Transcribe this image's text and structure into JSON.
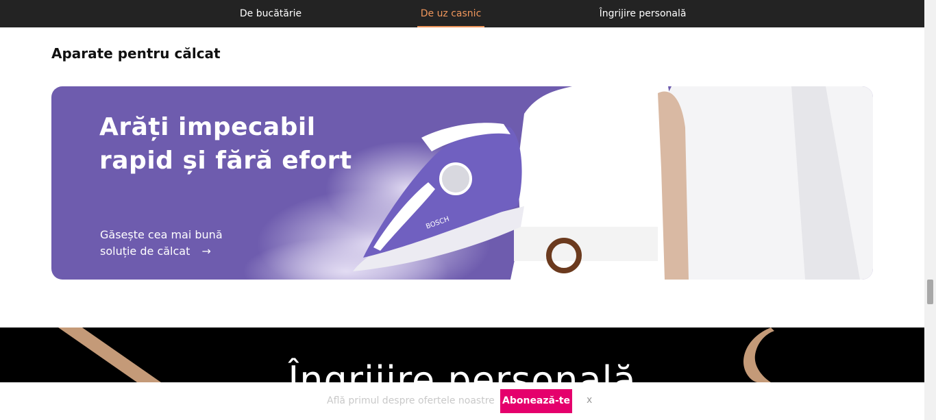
{
  "nav": {
    "items": [
      {
        "label": "De bucătărie"
      },
      {
        "label": "De uz casnic"
      },
      {
        "label": "Îngrijire personală"
      }
    ],
    "active_index": 1,
    "accent_color": "#f0975c"
  },
  "section": {
    "title": "Aparate pentru călcat"
  },
  "banner": {
    "headline_line1": "Arăți impecabil",
    "headline_line2": "rapid și fără efort",
    "cta_line1": "Găsește cea mai bună",
    "cta_line2": "soluție de călcat",
    "arrow_icon": "arrow-right-icon",
    "background_color": "#6e5cae",
    "iron_brand": "BOSCH"
  },
  "next_section": {
    "title": "Îngrijire personală"
  },
  "subscribe": {
    "text": "Află primul despre ofertele noastre",
    "button_label": "Abonează-te",
    "close_label": "x",
    "button_color": "#e5006c"
  }
}
